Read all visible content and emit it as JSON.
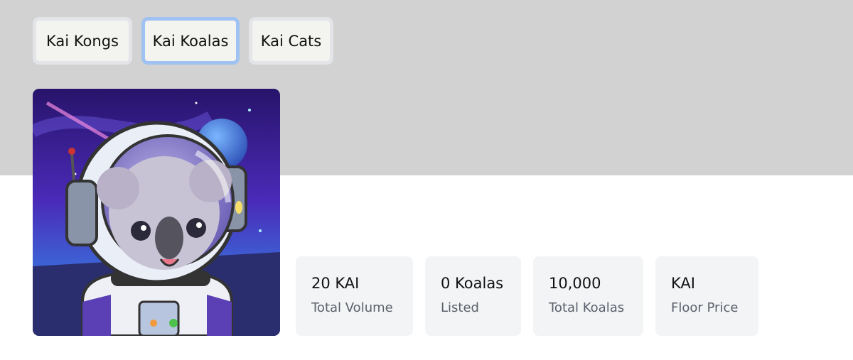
{
  "tabs": [
    {
      "label": "Kai Kongs",
      "active": false
    },
    {
      "label": "Kai Koalas",
      "active": true
    },
    {
      "label": "Kai Cats",
      "active": false
    }
  ],
  "collection": {
    "avatar_alt": "Kai Koala astronaut"
  },
  "stats": [
    {
      "value": "20 KAI",
      "label": "Total Volume"
    },
    {
      "value": "0 Koalas",
      "label": "Listed"
    },
    {
      "value": "10,000",
      "label": "Total Koalas"
    },
    {
      "value": "KAI",
      "label": "Floor Price"
    }
  ],
  "colors": {
    "banner": "#d2d2d2",
    "active_tab_border": "#9fc2f2",
    "tab_border": "#e3e4e8",
    "stat_card": "#f3f4f6"
  }
}
